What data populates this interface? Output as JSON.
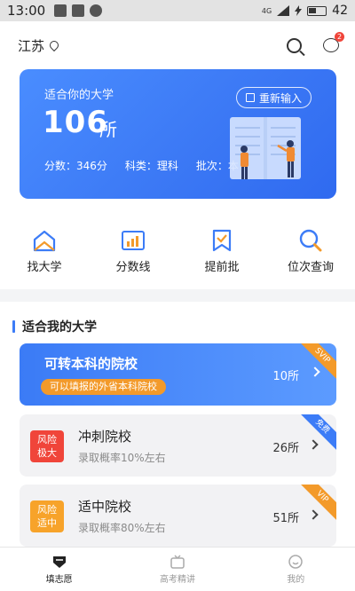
{
  "status_bar": {
    "time": "13:00",
    "signal": "4G",
    "battery": "42"
  },
  "header": {
    "location": "江苏"
  },
  "hero": {
    "subtitle": "适合你的大学",
    "count": "106",
    "unit": "所",
    "reinput_label": "重新输入",
    "score": "分数：346分",
    "subject": "科类：理科",
    "batch": "批次：本"
  },
  "quick_nav": [
    {
      "label": "找大学",
      "icon": "house-icon"
    },
    {
      "label": "分数线",
      "icon": "bar-chart-icon"
    },
    {
      "label": "提前批",
      "icon": "bookmark-check-icon"
    },
    {
      "label": "位次查询",
      "icon": "magnifier-icon"
    }
  ],
  "section": {
    "title": "适合我的大学"
  },
  "promo": {
    "title": "可转本科的院校",
    "tag": "可以填报的外省本科院校",
    "count": "10所",
    "corner": "SVIP"
  },
  "cards": [
    {
      "badge": "风险\n极大",
      "badge_line1": "风险",
      "badge_line2": "极大",
      "title": "冲刺院校",
      "subtitle": "录取概率10%左右",
      "count": "26所",
      "corner": "免费",
      "badge_color": "#f0453a",
      "corner_color": "#3c7cf7"
    },
    {
      "badge_line1": "风险",
      "badge_line2": "适中",
      "title": "适中院校",
      "subtitle": "录取概率80%左右",
      "count": "51所",
      "corner": "VIP",
      "badge_color": "#f7a32a",
      "corner_color": "#f39a2a"
    }
  ],
  "tabs": [
    {
      "label": "填志愿",
      "active": true
    },
    {
      "label": "高考精讲",
      "active": false
    },
    {
      "label": "我的",
      "active": false
    }
  ]
}
